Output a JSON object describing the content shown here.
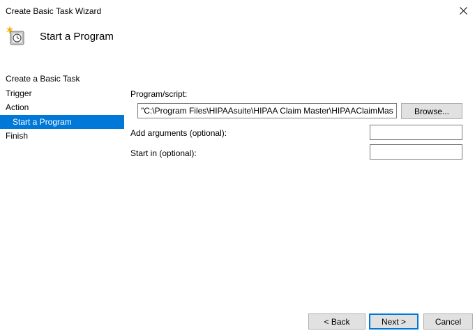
{
  "window": {
    "title": "Create Basic Task Wizard"
  },
  "header": {
    "title": "Start a Program",
    "icon": "task-scheduler-clock-icon"
  },
  "sidebar": {
    "steps": [
      {
        "label": "Create a Basic Task"
      },
      {
        "label": "Trigger"
      },
      {
        "label": "Action"
      },
      {
        "label": "Start a Program"
      },
      {
        "label": "Finish"
      }
    ],
    "active_step": "Start a Program"
  },
  "form": {
    "program_label": "Program/script:",
    "program_value": "\"C:\\Program Files\\HIPAAsuite\\HIPAA Claim Master\\HIPAAClaimMaster.exe\"",
    "browse_label": "Browse...",
    "arguments_label": "Add arguments (optional):",
    "arguments_value": "",
    "start_in_label": "Start in (optional):",
    "start_in_value": ""
  },
  "footer": {
    "back_label": "< Back",
    "next_label": "Next >",
    "cancel_label": "Cancel"
  },
  "colors": {
    "selection": "#0078d7",
    "button_face": "#e1e1e1",
    "textbox_border": "#7a7a7a"
  }
}
